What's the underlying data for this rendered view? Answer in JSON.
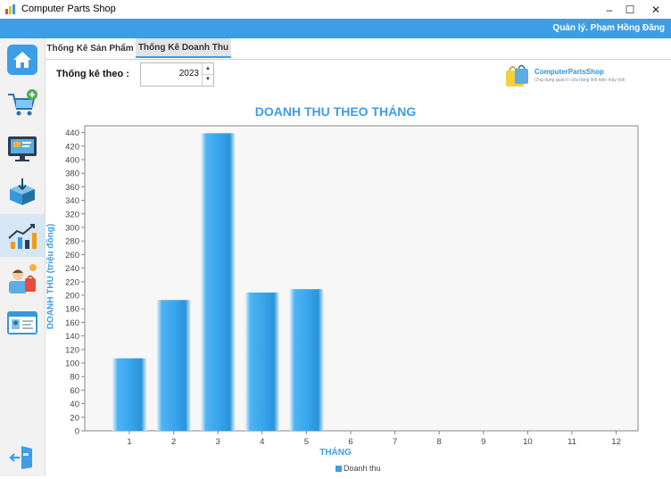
{
  "window": {
    "title": "Computer Parts Shop",
    "minimize_glyph": "–",
    "maximize_glyph": "☐",
    "close_glyph": "✕"
  },
  "header": {
    "user_label": "Quản lý. Phạm Hồng Đăng",
    "background": "#3d9de6"
  },
  "sidebar": {
    "items": [
      {
        "icon": "home-icon",
        "active": false
      },
      {
        "icon": "cart-add-icon",
        "active": false
      },
      {
        "icon": "monitor-icon",
        "active": false
      },
      {
        "icon": "import-box-icon",
        "active": false
      },
      {
        "icon": "statistics-chart-icon",
        "active": true
      },
      {
        "icon": "customer-staff-icon",
        "active": false
      },
      {
        "icon": "id-card-icon",
        "active": false
      }
    ],
    "logout_icon": "logout-icon"
  },
  "tabs": [
    {
      "label": "Thống Kê Sản Phẩm",
      "active": false
    },
    {
      "label": "Thống Kê Doanh Thu",
      "active": true
    }
  ],
  "filter": {
    "label": "Thống kê theo :",
    "year_value": "2023"
  },
  "logo": {
    "name": "ComputerPartsShop",
    "tagline": "Ứng dụng quản lí cửa hàng linh kiện máy tính"
  },
  "chart_data": {
    "type": "bar",
    "title": "DOANH THU THEO THÁNG",
    "xlabel": "THÁNG",
    "ylabel": "DOANH THU (triệu đồng)",
    "categories": [
      "1",
      "2",
      "3",
      "4",
      "5",
      "6",
      "7",
      "8",
      "9",
      "10",
      "11",
      "12"
    ],
    "series": [
      {
        "name": "Doanh thu",
        "values": [
          107,
          193,
          439,
          204,
          209,
          0,
          0,
          0,
          0,
          0,
          0,
          0
        ],
        "color": "#3d9de6"
      }
    ],
    "ylim": [
      0,
      450
    ],
    "yticks": [
      0,
      20,
      40,
      60,
      80,
      100,
      120,
      140,
      160,
      180,
      200,
      220,
      240,
      260,
      280,
      300,
      320,
      340,
      360,
      380,
      400,
      420,
      440
    ],
    "grid": false,
    "legend": "bottom-center"
  }
}
